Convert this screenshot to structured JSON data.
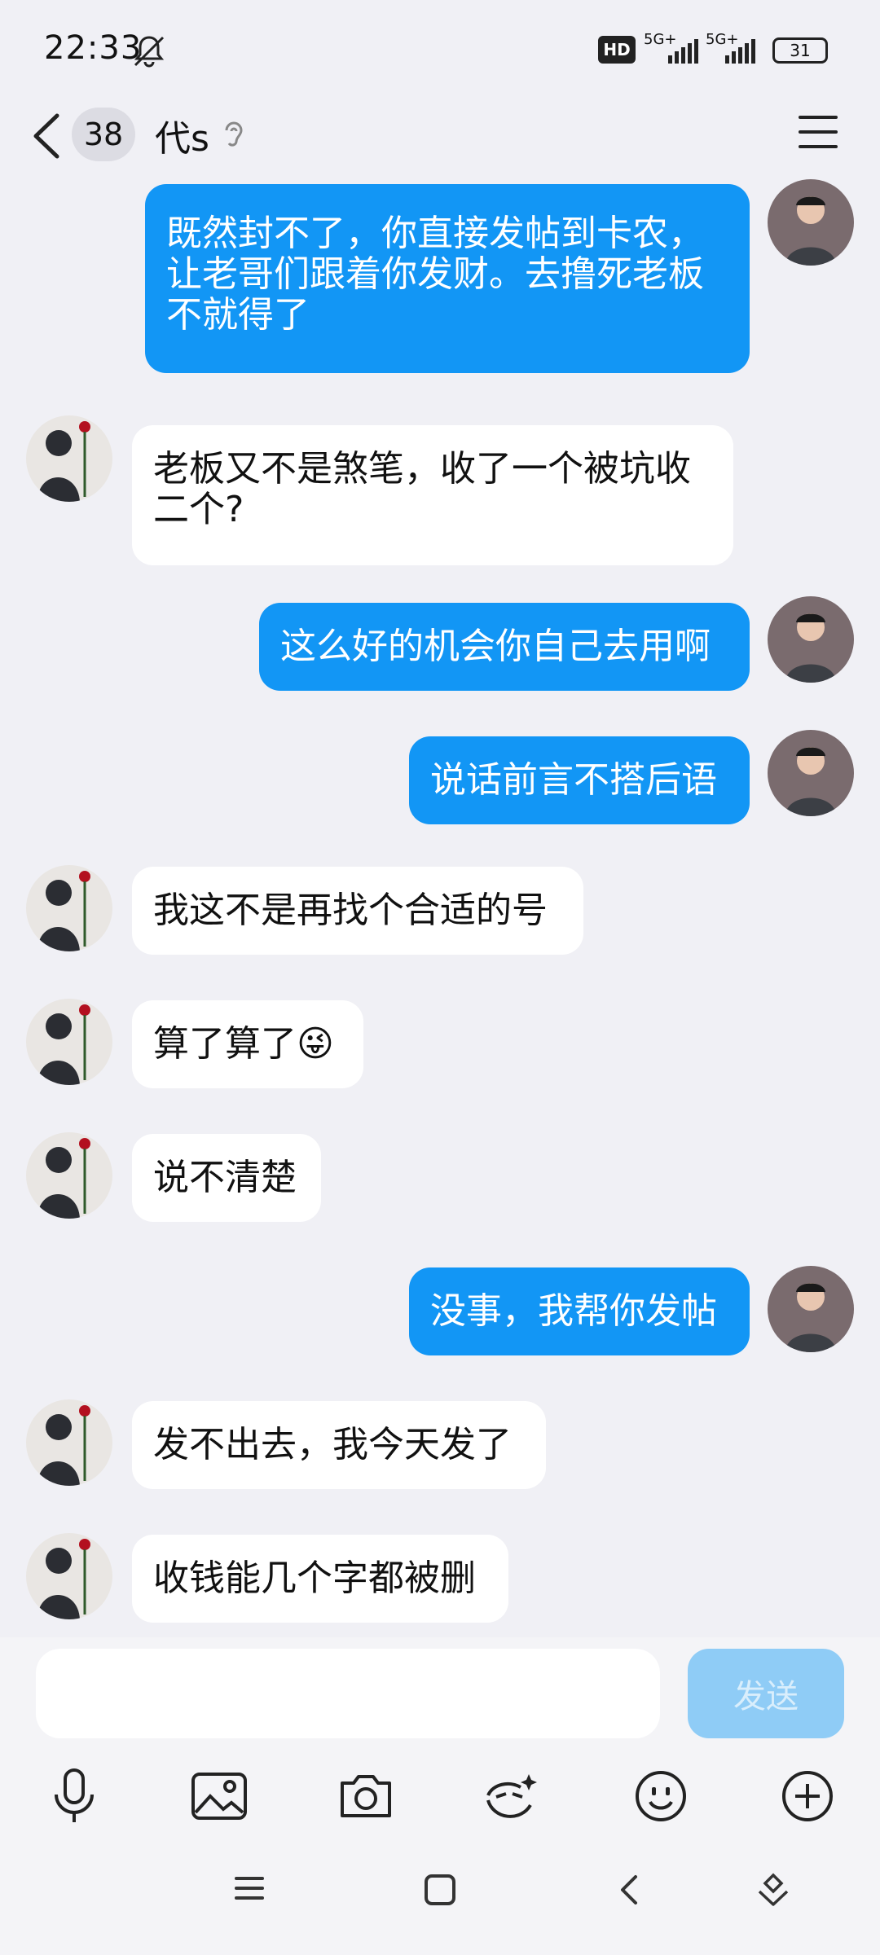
{
  "status": {
    "time": "22:33",
    "hd_label": "HD",
    "network1": "5G+",
    "network2": "5G+",
    "battery": "31"
  },
  "header": {
    "unread_count": "38",
    "title": "代s"
  },
  "messages": [
    {
      "side": "out",
      "text": "既然封不了，你直接发帖到卡农，\n让老哥们跟着你发财。去撸死老板\n不就得了"
    },
    {
      "side": "in",
      "text": "老板又不是煞笔，收了一个被坑收\n二个?"
    },
    {
      "side": "out",
      "text": "这么好的机会你自己去用啊"
    },
    {
      "side": "out",
      "text": "说话前言不搭后语"
    },
    {
      "side": "in",
      "text": "我这不是再找个合适的号"
    },
    {
      "side": "in",
      "text": "算了算了😜"
    },
    {
      "side": "in",
      "text": "说不清楚"
    },
    {
      "side": "out",
      "text": "没事，我帮你发帖"
    },
    {
      "side": "in",
      "text": "发不出去，我今天发了"
    },
    {
      "side": "in",
      "text": "收钱能几个字都被删"
    }
  ],
  "composer": {
    "placeholder": "",
    "send_label": "发送"
  },
  "colors": {
    "outgoing_bubble": "#1296f5",
    "incoming_bubble": "#ffffff",
    "background": "#f0f0f5",
    "send_disabled": "#8fccf6"
  }
}
